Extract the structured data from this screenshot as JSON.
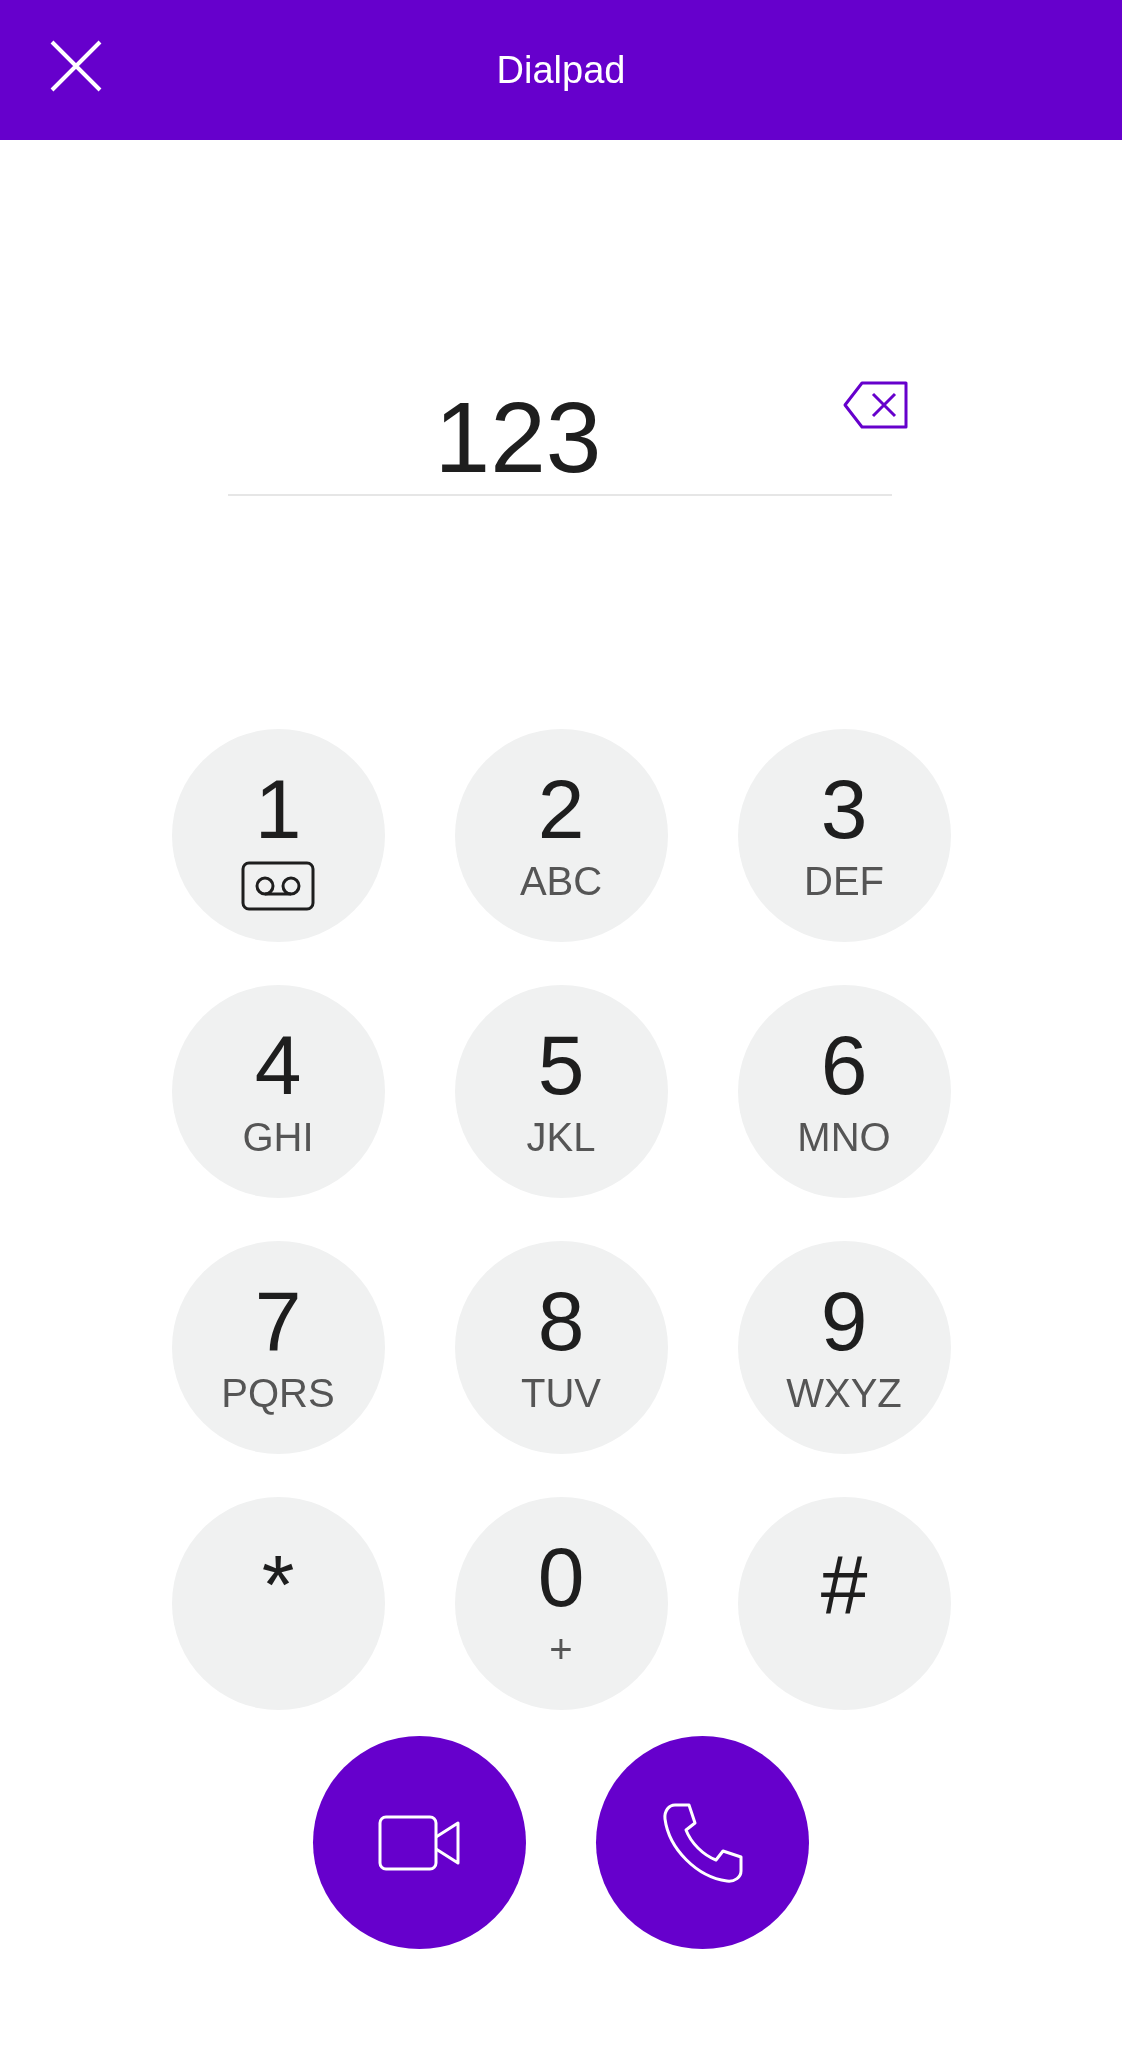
{
  "header": {
    "title": "Dialpad"
  },
  "number_field": {
    "value": "123"
  },
  "keys": [
    {
      "digit": "1",
      "kind": "voicemail"
    },
    {
      "digit": "2",
      "kind": "letters",
      "letters": "ABC"
    },
    {
      "digit": "3",
      "kind": "letters",
      "letters": "DEF"
    },
    {
      "digit": "4",
      "kind": "letters",
      "letters": "GHI"
    },
    {
      "digit": "5",
      "kind": "letters",
      "letters": "JKL"
    },
    {
      "digit": "6",
      "kind": "letters",
      "letters": "MNO"
    },
    {
      "digit": "7",
      "kind": "letters",
      "letters": "PQRS"
    },
    {
      "digit": "8",
      "kind": "letters",
      "letters": "TUV"
    },
    {
      "digit": "9",
      "kind": "letters",
      "letters": "WXYZ"
    },
    {
      "digit": "*",
      "kind": "symbol"
    },
    {
      "digit": "0",
      "kind": "letters",
      "letters": "+"
    },
    {
      "digit": "#",
      "kind": "symbol"
    }
  ],
  "call_buttons": [
    {
      "kind": "video"
    },
    {
      "kind": "voice"
    }
  ]
}
